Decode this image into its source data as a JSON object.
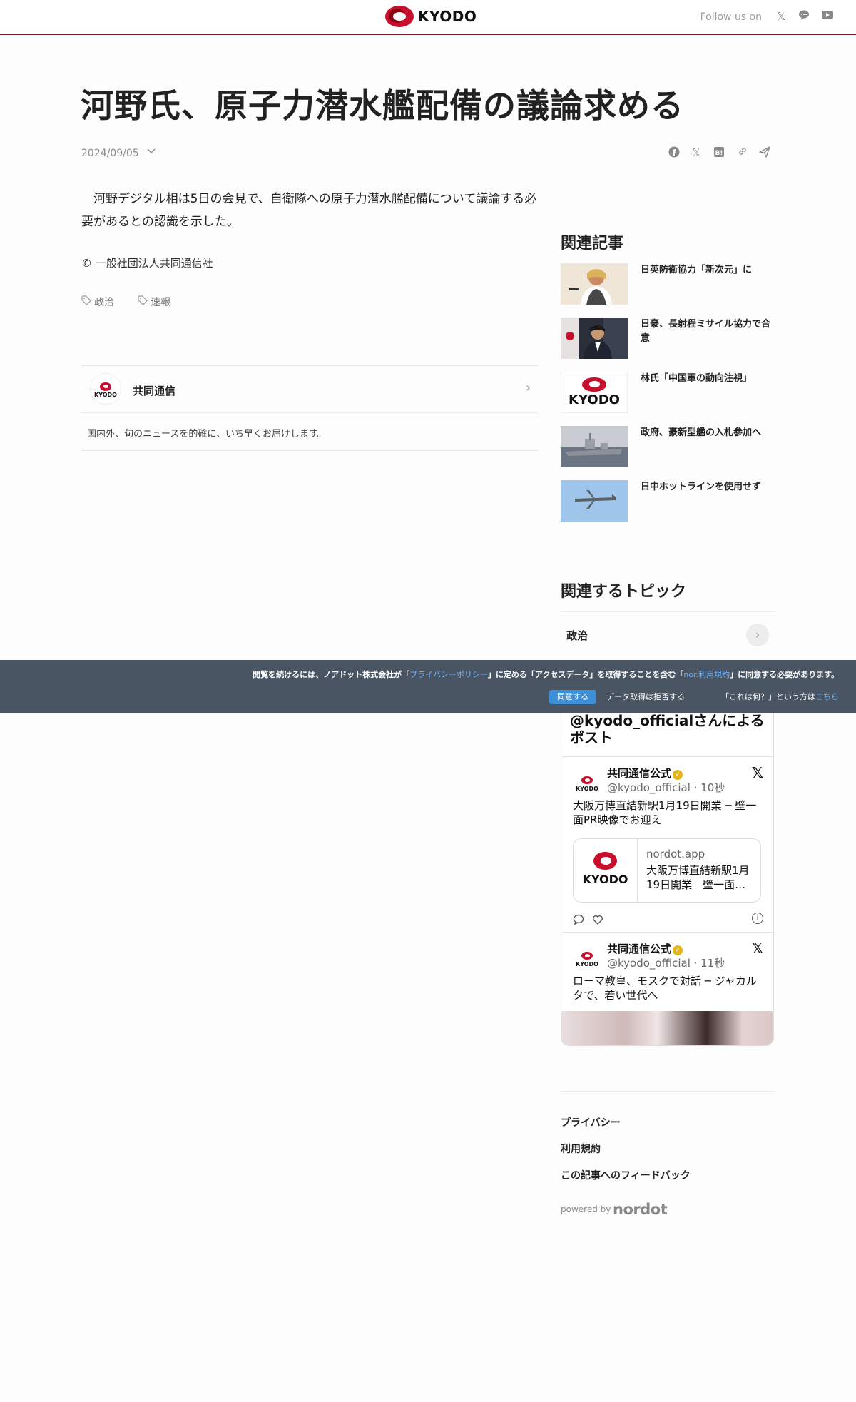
{
  "header": {
    "logo_text": "KYODO",
    "follow_label": "Follow us on",
    "social_icons": [
      "x-icon",
      "line-icon",
      "youtube-icon"
    ]
  },
  "article": {
    "title": "河野氏、原子力潜水艦配備の議論求める",
    "date": "2024/09/05",
    "body": "　河野デジタル相は5日の会見で、自衛隊への原子力潜水艦配備について議論する必要があるとの認識を示した。",
    "copyright": "© 一般社団法人共同通信社",
    "tags": [
      "政治",
      "速報"
    ],
    "share_icons": [
      "facebook-icon",
      "x-icon",
      "hatena-bookmark-icon",
      "copy-link-icon",
      "send-icon"
    ]
  },
  "publisher": {
    "avatar_text": "KYODO",
    "name": "共同通信",
    "description": "国内外、旬のニュースを的確に、いち早くお届けします。"
  },
  "sidebar": {
    "related_heading": "関連記事",
    "related": [
      {
        "title": "日英防衛協力「新次元」に"
      },
      {
        "title": "日豪、長射程ミサイル協力で合意"
      },
      {
        "title": "林氏「中国軍の動向注視」"
      },
      {
        "title": "政府、豪新型艦の入札参加へ"
      },
      {
        "title": "日中ホットラインを使用せず"
      }
    ],
    "topics_heading": "関連するトピック",
    "topics": [
      {
        "label": "政治"
      }
    ]
  },
  "twitter": {
    "heading": "@kyodo_officialさんによるポスト",
    "posts": [
      {
        "name": "共同通信公式",
        "handle": "@kyodo_official · 10秒",
        "text": "大阪万博直結新駅1月19日開業 ─ 壁一面PR映像でお迎え",
        "card_domain": "nordot.app",
        "card_title": "大阪万博直結新駅1月19日開業　壁一面…",
        "card_logo": "KYODO"
      },
      {
        "name": "共同通信公式",
        "handle": "@kyodo_official · 11秒",
        "text": "ローマ教皇、モスクで対話 ─ ジャカルタで、若い世代へ"
      }
    ]
  },
  "footer": {
    "links": [
      "プライバシー",
      "利用規約",
      "この記事へのフィードバック"
    ],
    "powered_by": "powered by",
    "brand": "nordot"
  },
  "consent": {
    "msg_part1": "閲覧を続けるには、ノアドット株式会社が「",
    "privacy_link": "プライバシーポリシー",
    "msg_part2": "」に定める「アクセスデータ」を取得することを含む「",
    "terms_link": "nor.利用規約",
    "msg_part3": "」に同意する必要があります。",
    "agree": "同意する",
    "refuse": "データ取得は拒否する",
    "what_prefix": "「これは何？」という方は",
    "what_link": "こちら"
  }
}
